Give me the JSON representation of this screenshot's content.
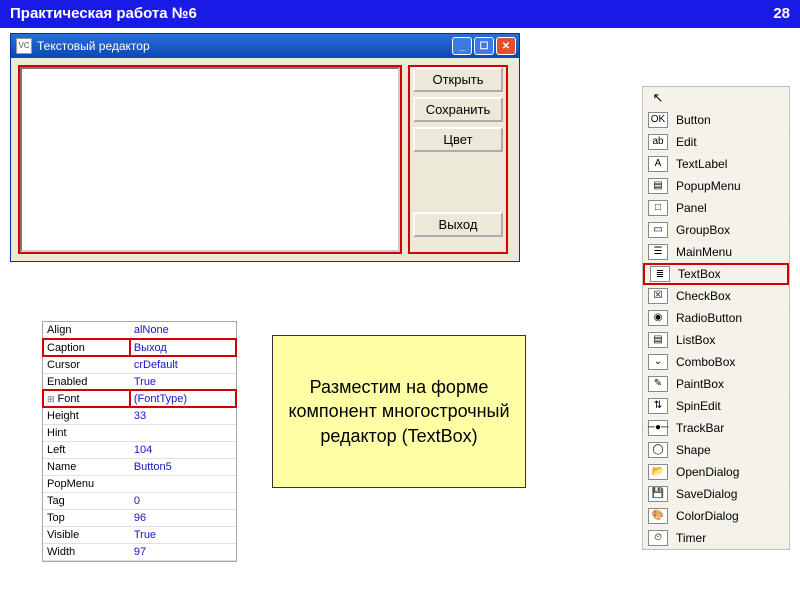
{
  "slide": {
    "title": "Практическая работа №6",
    "number": "28"
  },
  "window": {
    "title": "Текстовый редактор",
    "buttons": {
      "open": "Открыть",
      "save": "Сохранить",
      "color": "Цвет",
      "exit": "Выход"
    }
  },
  "props": [
    {
      "name": "Align",
      "value": "alNone",
      "hl": false,
      "exp": false
    },
    {
      "name": "Caption",
      "value": "Выход",
      "hl": true,
      "exp": false
    },
    {
      "name": "Cursor",
      "value": "crDefault",
      "hl": false,
      "exp": false
    },
    {
      "name": "Enabled",
      "value": "True",
      "hl": false,
      "exp": false
    },
    {
      "name": "Font",
      "value": "(FontType)",
      "hl": true,
      "exp": true
    },
    {
      "name": "Height",
      "value": "33",
      "hl": false,
      "exp": false
    },
    {
      "name": "Hint",
      "value": "",
      "hl": false,
      "exp": false
    },
    {
      "name": "Left",
      "value": "104",
      "hl": false,
      "exp": false
    },
    {
      "name": "Name",
      "value": "Button5",
      "hl": false,
      "exp": false
    },
    {
      "name": "PopMenu",
      "value": "",
      "hl": false,
      "exp": false
    },
    {
      "name": "Tag",
      "value": "0",
      "hl": false,
      "exp": false
    },
    {
      "name": "Top",
      "value": "96",
      "hl": false,
      "exp": false
    },
    {
      "name": "Visible",
      "value": "True",
      "hl": false,
      "exp": false
    },
    {
      "name": "Width",
      "value": "97",
      "hl": false,
      "exp": false
    }
  ],
  "callout": {
    "text": "Разместим на форме компонент многострочный редактор (TextBox)"
  },
  "palette": {
    "arrow": "↖",
    "items": [
      {
        "label": "Button",
        "icon": "OK",
        "sel": false
      },
      {
        "label": "Edit",
        "icon": "ab",
        "sel": false
      },
      {
        "label": "TextLabel",
        "icon": "A",
        "sel": false
      },
      {
        "label": "PopupMenu",
        "icon": "▤",
        "sel": false
      },
      {
        "label": "Panel",
        "icon": "□",
        "sel": false
      },
      {
        "label": "GroupBox",
        "icon": "▭",
        "sel": false
      },
      {
        "label": "MainMenu",
        "icon": "☰",
        "sel": false
      },
      {
        "label": "TextBox",
        "icon": "≣",
        "sel": true
      },
      {
        "label": "CheckBox",
        "icon": "☒",
        "sel": false
      },
      {
        "label": "RadioButton",
        "icon": "◉",
        "sel": false
      },
      {
        "label": "ListBox",
        "icon": "▤",
        "sel": false
      },
      {
        "label": "ComboBox",
        "icon": "⌄",
        "sel": false
      },
      {
        "label": "PaintBox",
        "icon": "✎",
        "sel": false
      },
      {
        "label": "SpinEdit",
        "icon": "⇅",
        "sel": false
      },
      {
        "label": "TrackBar",
        "icon": "─●─",
        "sel": false
      },
      {
        "label": "Shape",
        "icon": "◯",
        "sel": false
      },
      {
        "label": "OpenDialog",
        "icon": "📂",
        "sel": false
      },
      {
        "label": "SaveDialog",
        "icon": "💾",
        "sel": false
      },
      {
        "label": "ColorDialog",
        "icon": "🎨",
        "sel": false
      },
      {
        "label": "Timer",
        "icon": "⏲",
        "sel": false
      }
    ]
  }
}
